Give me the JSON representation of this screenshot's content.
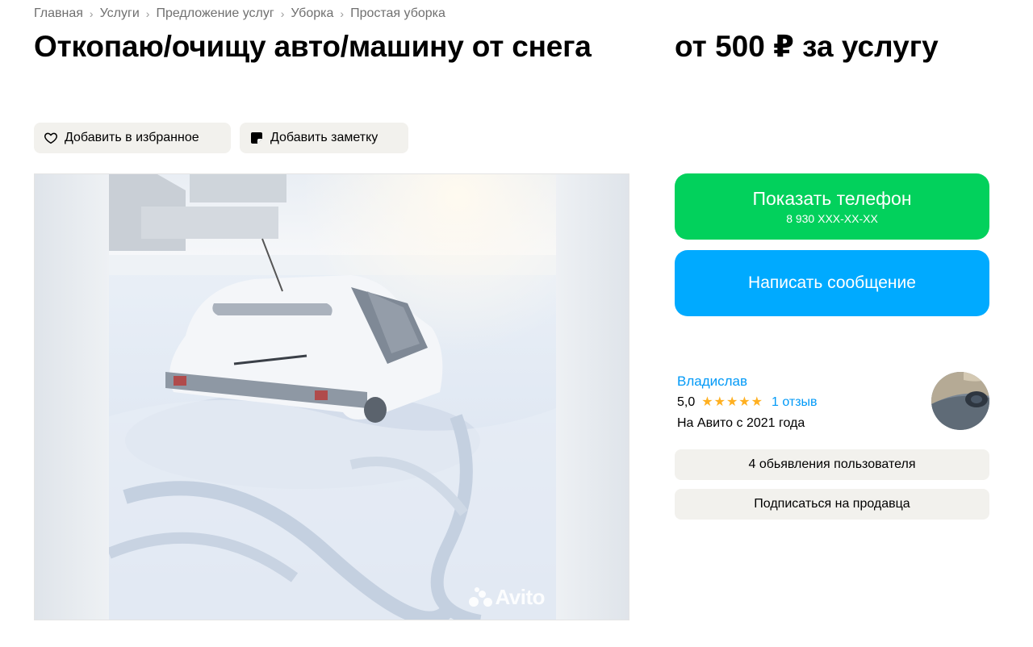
{
  "breadcrumbs": [
    "Главная",
    "Услуги",
    "Предложение услуг",
    "Уборка",
    "Простая уборка"
  ],
  "title": "Откопаю/очищу авто/машину от снега",
  "price": "от 500 ₽ за услугу",
  "actions": {
    "favorite": "Добавить в избранное",
    "note": "Добавить заметку"
  },
  "gallery": {
    "watermark": "Avito"
  },
  "contact": {
    "show_phone": "Показать телефон",
    "phone_masked": "8 930 XXX-XX-XX",
    "write_message": "Написать сообщение"
  },
  "seller": {
    "name": "Владислав",
    "rating": "5,0",
    "stars": 5,
    "reviews": "1 отзыв",
    "since": "На Авито с 2021 года",
    "listings": "4 обьявления пользователя",
    "subscribe": "Подписаться на продавца"
  },
  "colors": {
    "green": "#02d15c",
    "blue": "#00aaff",
    "link": "#0099f7",
    "star": "#ffb021",
    "grey_button": "#f2f1ed"
  }
}
